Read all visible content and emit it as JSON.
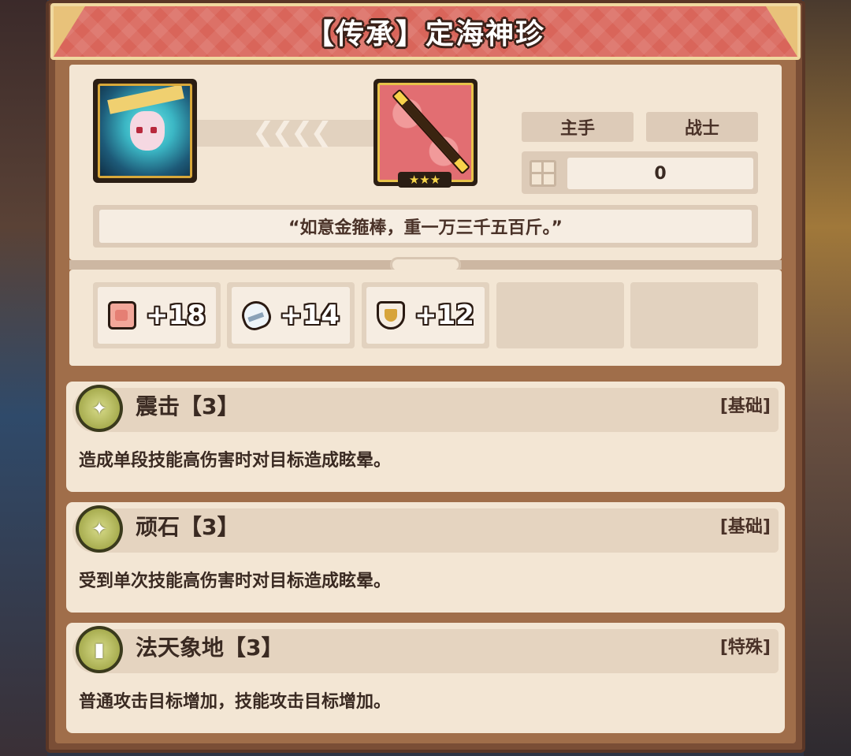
{
  "title": "【传承】定海神珍",
  "equipment": {
    "slot_tag": "主手",
    "class_tag": "战士",
    "power_value": "0",
    "rarity_stars": 3,
    "quote": "“如意金箍棒，重一万三千五百斤。”"
  },
  "stats": [
    {
      "icon": "fist-icon",
      "value": "+18"
    },
    {
      "icon": "shoe-icon",
      "value": "+14"
    },
    {
      "icon": "shield-icon",
      "value": "+12"
    }
  ],
  "skills": [
    {
      "name": "震击【3】",
      "type": "[基础]",
      "description": "造成单段技能高伤害时对目标造成眩晕。",
      "icon": "sparkle-medal-icon"
    },
    {
      "name": "顽石【3】",
      "type": "[基础]",
      "description": "受到单次技能高伤害时对目标造成眩晕。",
      "icon": "sparkle-medal-icon"
    },
    {
      "name": "法天象地【3】",
      "type": "[特殊]",
      "description": "普通攻击目标增加，技能攻击目标增加。",
      "icon": "pillar-medal-icon"
    }
  ],
  "colors": {
    "banner": "#d9655a",
    "panel_frame": "#7a4e36",
    "card_bg": "#f3e6d4",
    "star_gold": "#f6d54a"
  }
}
